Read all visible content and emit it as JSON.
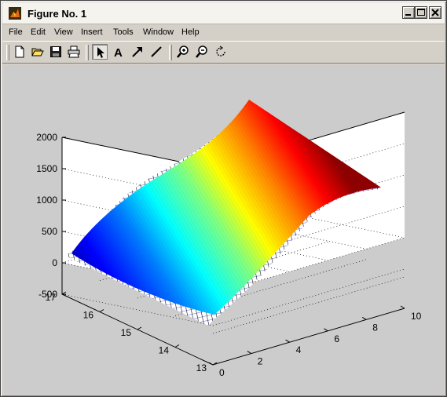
{
  "window": {
    "title": "Figure No. 1"
  },
  "title_buttons": {
    "minimize_icon": "minimize-icon",
    "maximize_icon": "maximize-icon",
    "close_icon": "close-icon"
  },
  "menu": [
    "File",
    "Edit",
    "View",
    "Insert",
    "Tools",
    "Window",
    "Help"
  ],
  "toolbar": {
    "tools": [
      "new-figure-icon",
      "open-file-icon",
      "save-icon",
      "print-icon",
      "edit-plot-arrow-icon",
      "insert-text-icon",
      "insert-arrow-icon",
      "insert-line-icon",
      "zoom-in-icon",
      "zoom-out-icon",
      "rotate-3d-icon"
    ],
    "insert_text_glyph": "A"
  },
  "colors": {
    "window_bg": "#d4d0c8",
    "figure_bg": "#cccccc",
    "axes_bg": "#ffffff",
    "surface_colormap": "jet"
  },
  "chart_data": {
    "type": "surface",
    "colormap": "jet",
    "grid": true,
    "title": "",
    "xlabel": "",
    "ylabel": "",
    "zlabel": "",
    "xlim": [
      0,
      10
    ],
    "ylim": [
      13,
      17
    ],
    "zlim": [
      -500,
      2000
    ],
    "x_ticks": [
      "0",
      "2",
      "4",
      "6",
      "8",
      "10"
    ],
    "y_ticks": [
      "13",
      "14",
      "15",
      "16",
      "17"
    ],
    "z_ticks": [
      "-500",
      "0",
      "500",
      "1000",
      "1500",
      "2000"
    ],
    "surface_z_at_x": {
      "x": [
        0,
        2,
        4,
        6,
        8,
        10
      ],
      "z": [
        0,
        700,
        1200,
        1550,
        1800,
        1950
      ]
    }
  }
}
